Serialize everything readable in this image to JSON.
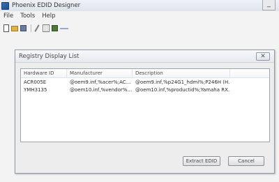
{
  "app": {
    "title": "Phoenix EDID Designer",
    "minimize_glyph": "_"
  },
  "menu": {
    "items": [
      "File",
      "Tools",
      "Help"
    ]
  },
  "toolbar": {
    "icons": [
      "new-file-icon",
      "open-folder-icon",
      "save-icon",
      "edit-icon",
      "grid-icon",
      "chip-icon",
      "wand-icon"
    ]
  },
  "dialog": {
    "title": "Registry Display List",
    "close_glyph": "✕",
    "columns": [
      "Hardware ID",
      "Manufacturer",
      "Description"
    ],
    "rows": [
      [
        "ACR005E",
        "@oem9.inf,%acer%;AC...",
        "@oem9.inf,%p24G1_hdmi%;P246H (H..."
      ],
      [
        "YMH3135",
        "@oem10.inf,%vendor%...",
        "@oem10.inf,%productid%;Yamaha RX..."
      ]
    ],
    "extract_label": "Extract EDID",
    "cancel_label": "Cancel"
  }
}
